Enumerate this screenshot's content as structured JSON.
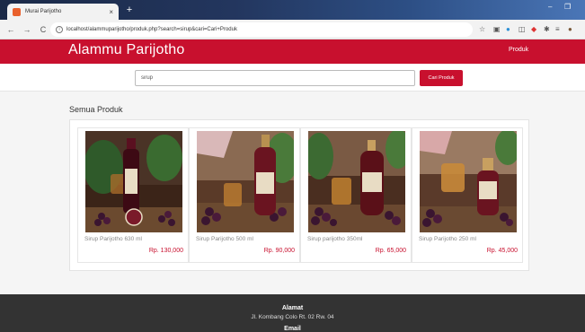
{
  "browser": {
    "tab_title": "Murai Parijotho",
    "tab_close": "×",
    "new_tab": "+",
    "url": "localhost/alammuparijotho/produk.php?search=sirup&cari=Cari+Produk",
    "back": "←",
    "forward": "→",
    "reload": "C",
    "minimize": "–",
    "restore": "❐"
  },
  "header": {
    "brand": "Alammu Parijotho",
    "nav_produk": "Produk",
    "accent_color": "#c8102e"
  },
  "search": {
    "value": "sirup",
    "button_label": "Cari Produk"
  },
  "main": {
    "section_title": "Semua Produk",
    "products": [
      {
        "name": "Sirup Parijotho 630 ml",
        "price": "Rp. 130,000"
      },
      {
        "name": "Sirup Parijotho 500 ml",
        "price": "Rp. 90,000"
      },
      {
        "name": "Sirup parijotho 350ml",
        "price": "Rp. 65,000"
      },
      {
        "name": "Sirup Parijotho 250 ml",
        "price": "Rp. 45,000"
      }
    ]
  },
  "footer": {
    "alamat_title": "Alamat",
    "alamat_value": "Jl. Kombang Colo Rt. 02 Rw. 04",
    "email_title": "Email"
  }
}
